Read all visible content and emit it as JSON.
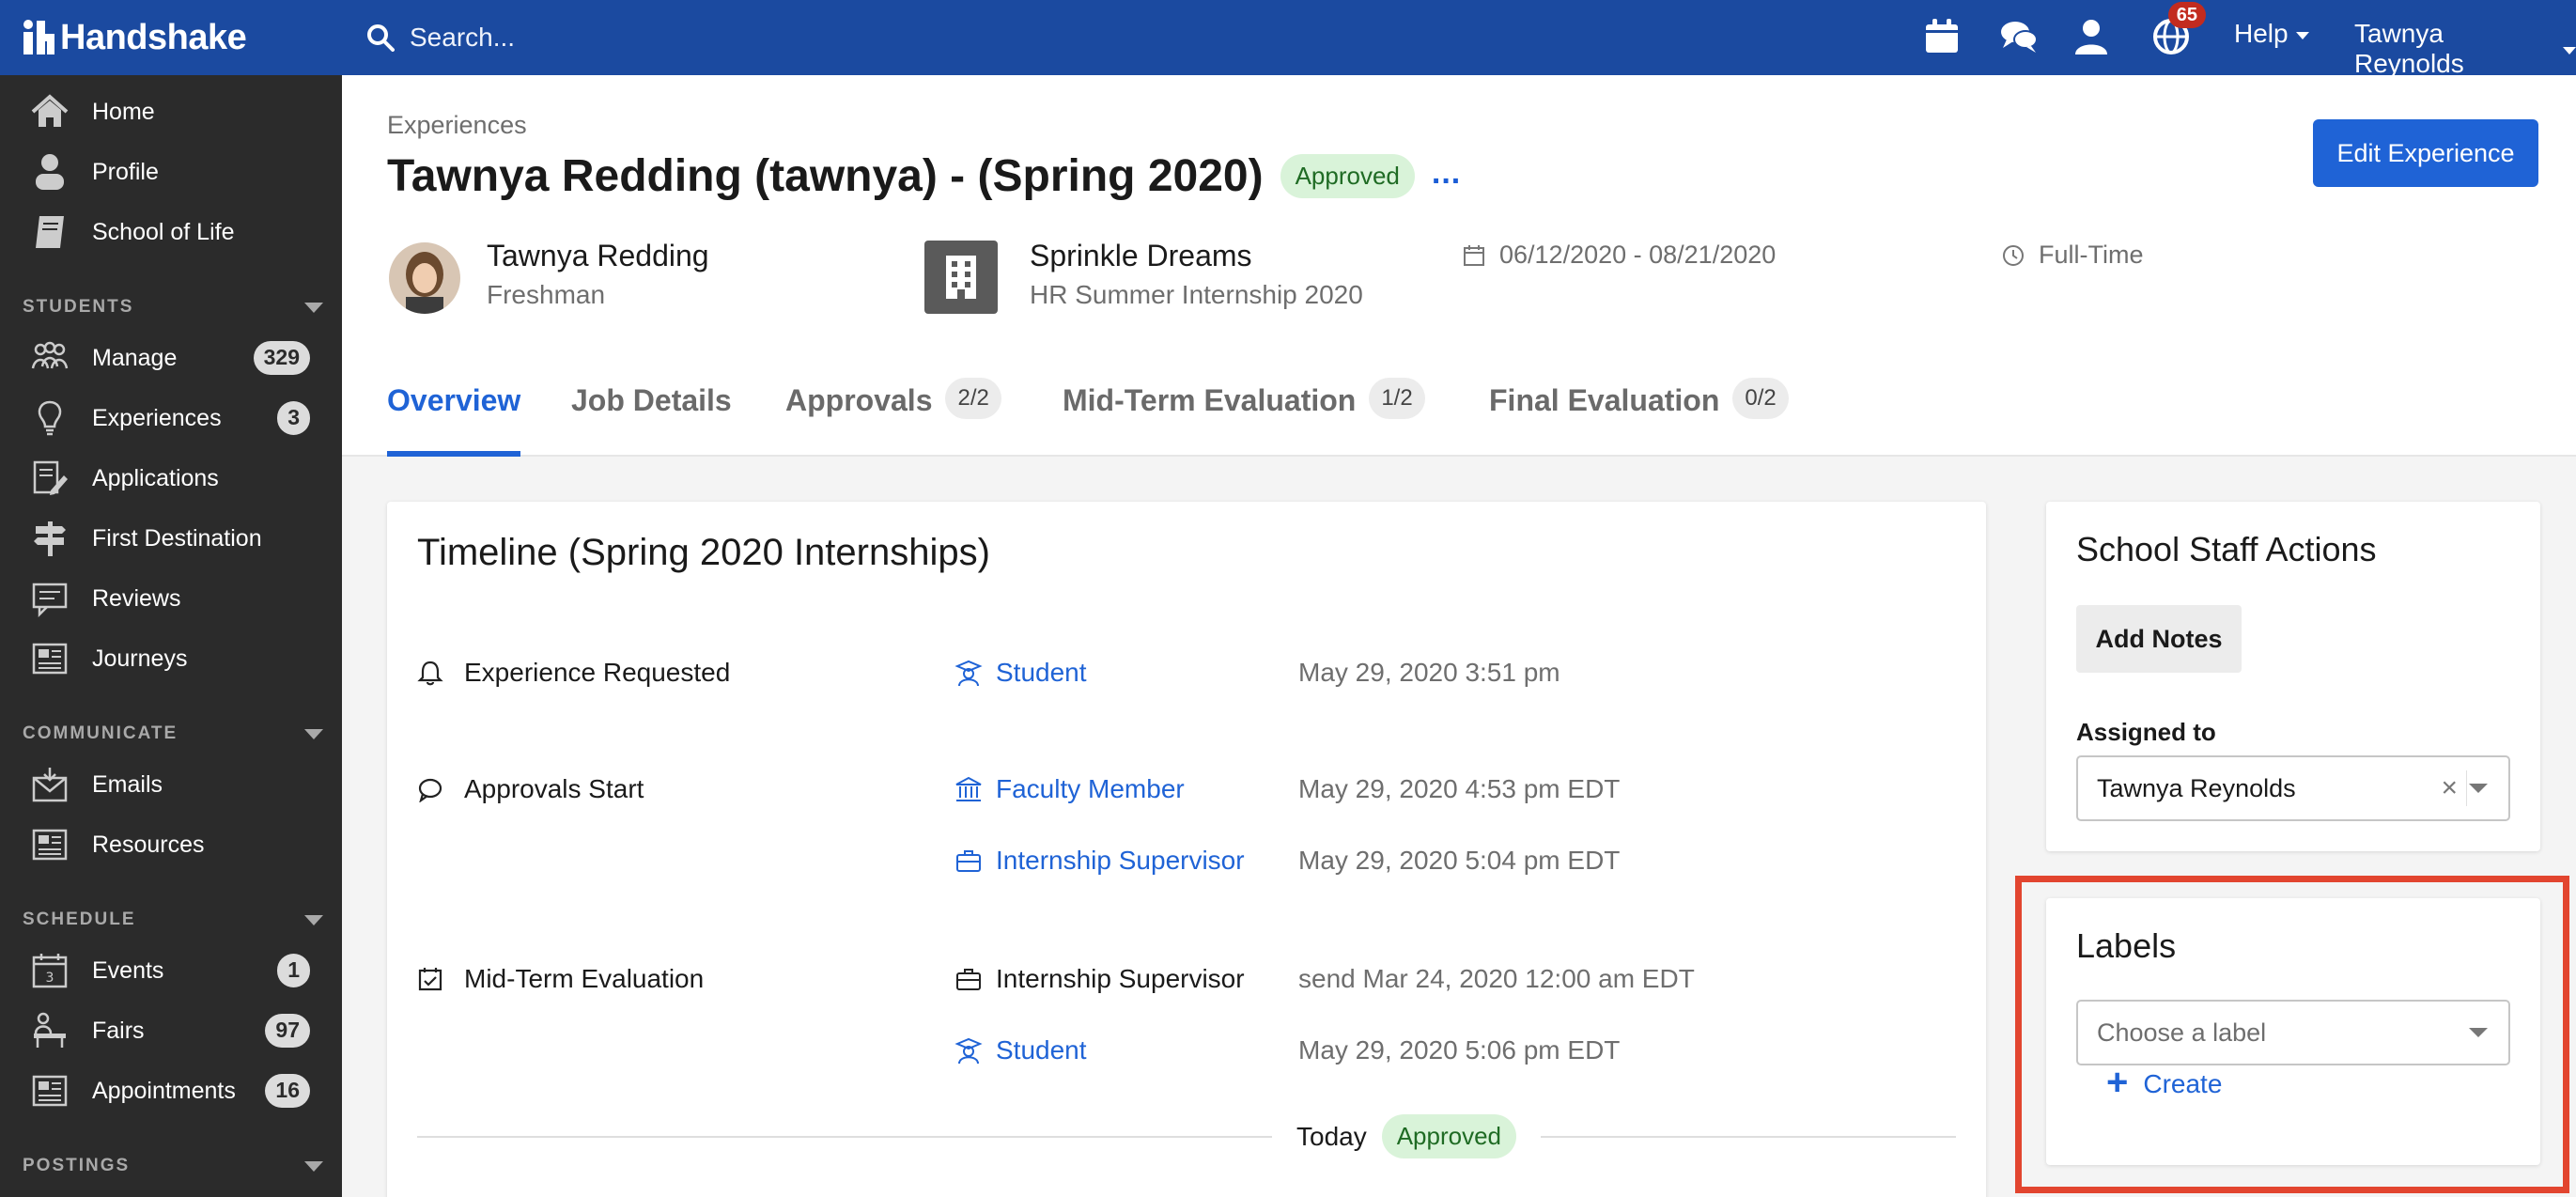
{
  "app": {
    "name": "Handshake"
  },
  "topbar": {
    "search_placeholder": "Search...",
    "notifications_count": "65",
    "help_label": "Help",
    "user_name": "Tawnya Reynolds"
  },
  "sidebar": {
    "items_main": [
      {
        "label": "Home",
        "icon": "home-icon"
      },
      {
        "label": "Profile",
        "icon": "profile-icon"
      },
      {
        "label": "School of Life",
        "icon": "book-icon"
      }
    ],
    "sections": {
      "students": "STUDENTS",
      "communicate": "COMMUNICATE",
      "schedule": "SCHEDULE",
      "postings": "POSTINGS"
    },
    "students_items": [
      {
        "label": "Manage",
        "count": "329"
      },
      {
        "label": "Experiences",
        "count": "3"
      },
      {
        "label": "Applications"
      },
      {
        "label": "First Destination"
      },
      {
        "label": "Reviews"
      },
      {
        "label": "Journeys"
      }
    ],
    "communicate_items": [
      {
        "label": "Emails"
      },
      {
        "label": "Resources"
      }
    ],
    "schedule_items": [
      {
        "label": "Events",
        "count": "1"
      },
      {
        "label": "Fairs",
        "count": "97"
      },
      {
        "label": "Appointments",
        "count": "16"
      }
    ]
  },
  "header": {
    "breadcrumb": "Experiences",
    "title": "Tawnya Redding (tawnya) - (Spring 2020)",
    "status": "Approved",
    "more": "...",
    "edit_button": "Edit Experience",
    "student_name": "Tawnya Redding",
    "student_year": "Freshman",
    "employer": "Sprinkle Dreams",
    "job_title": "HR Summer Internship 2020",
    "dates": "06/12/2020 - 08/21/2020",
    "employment_type": "Full-Time"
  },
  "tabs": [
    {
      "label": "Overview"
    },
    {
      "label": "Job Details"
    },
    {
      "label": "Approvals",
      "count": "2/2"
    },
    {
      "label": "Mid-Term Evaluation",
      "count": "1/2"
    },
    {
      "label": "Final Evaluation",
      "count": "0/2"
    }
  ],
  "timeline": {
    "title": "Timeline (Spring 2020 Internships)",
    "events": [
      {
        "event": "Experience Requested",
        "icon": "bell-icon"
      },
      {
        "event": "Approvals Start",
        "icon": "speech-bubble-icon"
      },
      {
        "event": "Mid-Term Evaluation",
        "icon": "calendar-check-icon"
      }
    ],
    "rows": [
      {
        "role": "Student",
        "time": "May 29, 2020 3:51 pm"
      },
      {
        "role": "Faculty Member",
        "time": "May 29, 2020 4:53 pm EDT"
      },
      {
        "role": "Internship Supervisor",
        "time": "May 29, 2020 5:04 pm EDT"
      },
      {
        "role": "Internship Supervisor",
        "time": "send Mar 24, 2020 12:00 am EDT"
      },
      {
        "role": "Student",
        "time": "May 29, 2020 5:06 pm EDT"
      }
    ],
    "today_label": "Today",
    "today_status": "Approved"
  },
  "staff_actions": {
    "title": "School Staff Actions",
    "add_notes": "Add Notes",
    "assigned_label": "Assigned to",
    "assigned_value": "Tawnya Reynolds"
  },
  "labels_panel": {
    "title": "Labels",
    "placeholder": "Choose a label",
    "create": "Create"
  },
  "colors": {
    "topbar": "#1b4aa0",
    "sidebar": "#2b2b2b",
    "accent": "#1f63d6",
    "approved_bg": "#d9f3d9",
    "approved_text": "#1f6b24",
    "highlight": "#e2452f"
  }
}
